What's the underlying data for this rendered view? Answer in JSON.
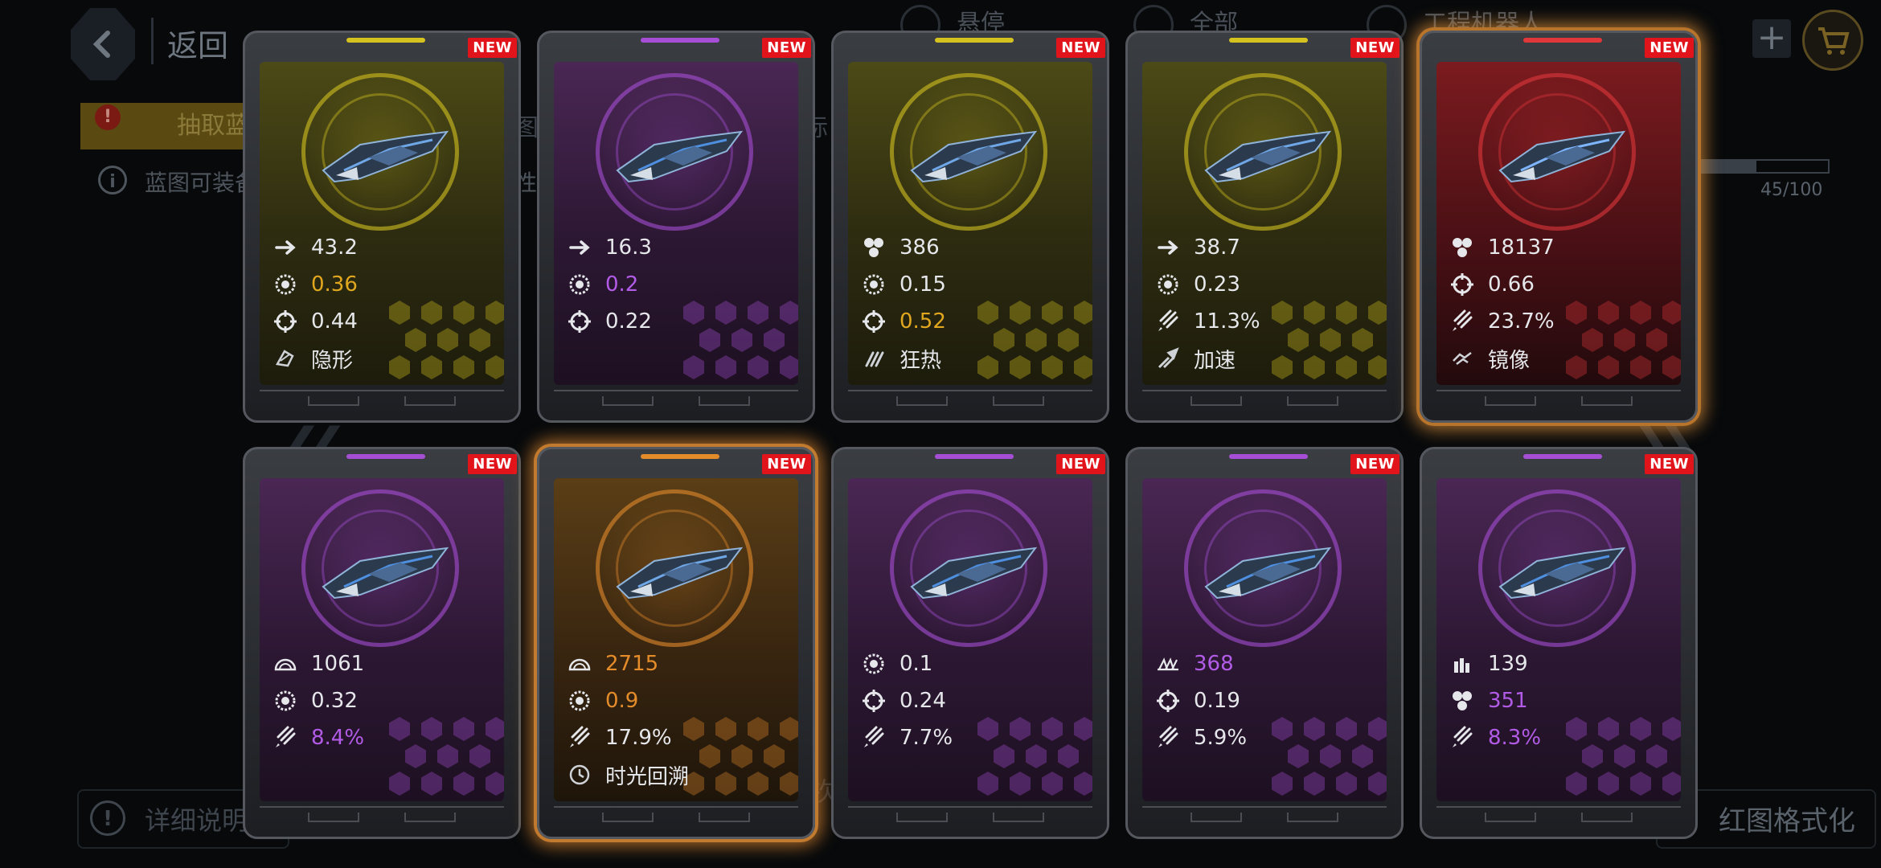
{
  "background": {
    "back_label": "返回",
    "top_tabs": [
      "悬停",
      "全部",
      "工程机器人"
    ],
    "draw_tab_label": "抽取蓝",
    "tab_fragment_1": "图",
    "tab_fragment_2": "标",
    "info_text": "蓝图可装备",
    "info_text_2": "性",
    "progress_label": "45/100",
    "progress_fraction": 0.45,
    "detail_label": "详细说明",
    "center_fragment": "次",
    "format_label": "红图格式化"
  },
  "badge_text": "NEW",
  "colors": {
    "yellow": "#d4c21f",
    "purple": "#a64fd6",
    "red": "#e0373b",
    "orange": "#e38a2b"
  },
  "cards": [
    {
      "rarity": "yellow",
      "stats": [
        {
          "icon": "speed-icon",
          "value": "43.2",
          "tone": "white"
        },
        {
          "icon": "gear-icon",
          "value": "0.36",
          "tone": "gold"
        },
        {
          "icon": "crosshair-icon",
          "value": "0.44",
          "tone": "white"
        },
        {
          "icon": "stealth-icon",
          "value": "隐形",
          "tone": "white"
        }
      ]
    },
    {
      "rarity": "purple",
      "stats": [
        {
          "icon": "speed-icon",
          "value": "16.3",
          "tone": "white"
        },
        {
          "icon": "gear-icon",
          "value": "0.2",
          "tone": "purple"
        },
        {
          "icon": "crosshair-icon",
          "value": "0.22",
          "tone": "white"
        }
      ]
    },
    {
      "rarity": "yellow",
      "stats": [
        {
          "icon": "cluster-icon",
          "value": "386",
          "tone": "white"
        },
        {
          "icon": "gear-icon",
          "value": "0.15",
          "tone": "white"
        },
        {
          "icon": "crosshair-icon",
          "value": "0.52",
          "tone": "gold"
        },
        {
          "icon": "frenzy-icon",
          "value": "狂热",
          "tone": "white"
        }
      ]
    },
    {
      "rarity": "yellow",
      "stats": [
        {
          "icon": "speed-icon",
          "value": "38.7",
          "tone": "white"
        },
        {
          "icon": "gear-icon",
          "value": "0.23",
          "tone": "white"
        },
        {
          "icon": "rocket-icon",
          "value": "11.3%",
          "tone": "white"
        },
        {
          "icon": "boost-icon",
          "value": "加速",
          "tone": "white"
        }
      ]
    },
    {
      "rarity": "red",
      "highlight": true,
      "stats": [
        {
          "icon": "cluster-icon",
          "value": "18137",
          "tone": "white"
        },
        {
          "icon": "crosshair-icon",
          "value": "0.66",
          "tone": "white"
        },
        {
          "icon": "rocket-icon",
          "value": "23.7%",
          "tone": "white"
        },
        {
          "icon": "mirror-icon",
          "value": "镜像",
          "tone": "white"
        }
      ]
    },
    {
      "rarity": "purple",
      "stats": [
        {
          "icon": "dome-icon",
          "value": "1061",
          "tone": "white"
        },
        {
          "icon": "gear-icon",
          "value": "0.32",
          "tone": "white"
        },
        {
          "icon": "rocket-icon",
          "value": "8.4%",
          "tone": "purple"
        }
      ]
    },
    {
      "rarity": "orange",
      "highlight": true,
      "stats": [
        {
          "icon": "dome-icon",
          "value": "2715",
          "tone": "orange"
        },
        {
          "icon": "gear-icon",
          "value": "0.9",
          "tone": "orange"
        },
        {
          "icon": "rocket-icon",
          "value": "17.9%",
          "tone": "white"
        },
        {
          "icon": "rewind-icon",
          "value": "时光回溯",
          "tone": "white"
        }
      ]
    },
    {
      "rarity": "purple",
      "stats": [
        {
          "icon": "gear-icon",
          "value": "0.1",
          "tone": "white"
        },
        {
          "icon": "crosshair-icon",
          "value": "0.24",
          "tone": "white"
        },
        {
          "icon": "rocket-icon",
          "value": "7.7%",
          "tone": "white"
        }
      ]
    },
    {
      "rarity": "purple",
      "stats": [
        {
          "icon": "spikes-icon",
          "value": "368",
          "tone": "purple"
        },
        {
          "icon": "crosshair-icon",
          "value": "0.19",
          "tone": "white"
        },
        {
          "icon": "rocket-icon",
          "value": "5.9%",
          "tone": "white"
        }
      ]
    },
    {
      "rarity": "purple",
      "stats": [
        {
          "icon": "ammo-icon",
          "value": "139",
          "tone": "white"
        },
        {
          "icon": "cluster-icon",
          "value": "351",
          "tone": "purple"
        },
        {
          "icon": "rocket-icon",
          "value": "8.3%",
          "tone": "purple"
        }
      ]
    }
  ]
}
